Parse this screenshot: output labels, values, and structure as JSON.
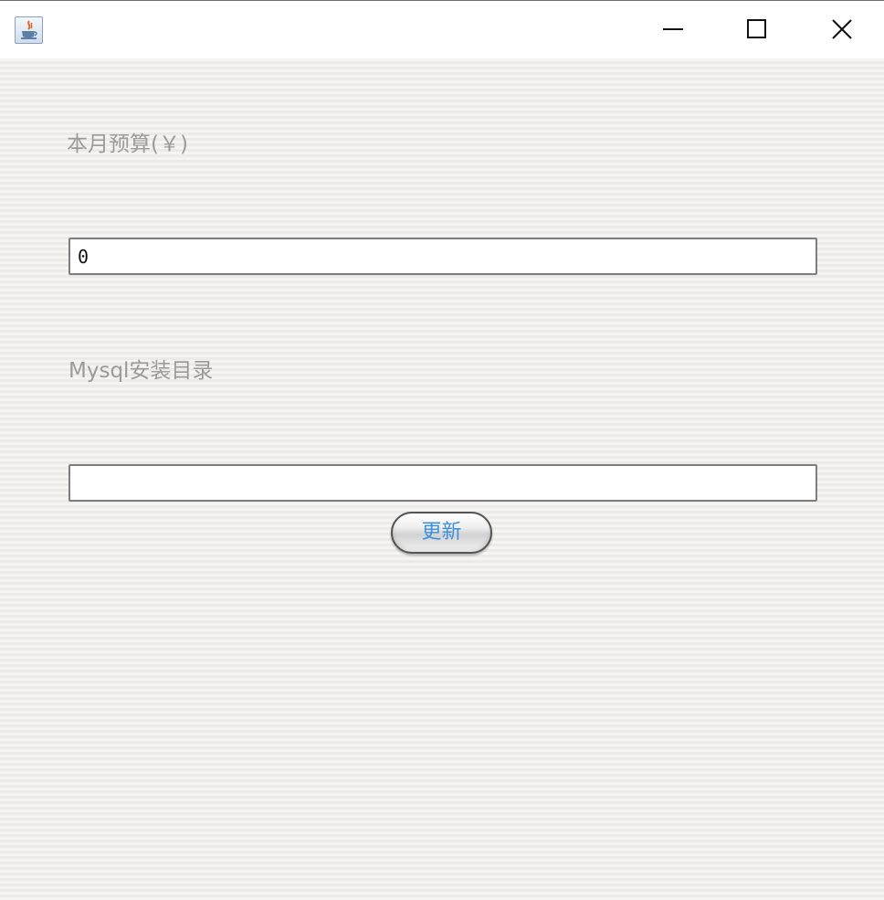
{
  "window": {
    "title": "",
    "controls": {
      "minimize_icon": "minimize-icon",
      "maximize_icon": "maximize-icon",
      "close_icon": "close-icon"
    }
  },
  "form": {
    "budget_label": "本月预算(￥)",
    "budget_value": "0",
    "mysql_label": "Mysql安装目录",
    "mysql_value": "",
    "update_button": "更新"
  },
  "colors": {
    "label_text": "#9a9a9a",
    "button_text": "#3d8fe0",
    "background_stripe_light": "#f5f4f2",
    "background_stripe_dark": "#ebeae8"
  }
}
